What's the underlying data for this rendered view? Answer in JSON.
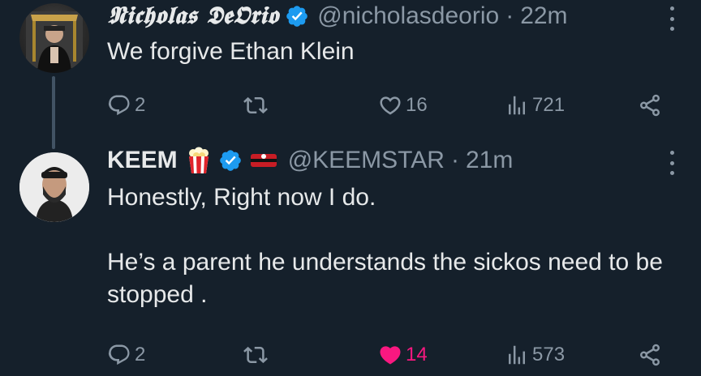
{
  "tweets": [
    {
      "name": "𝕹𝖎𝖈𝖍𝖔𝖑𝖆𝖘 𝕯𝖊𝕺𝖗𝖎𝖔",
      "handle": "@nicholasdeorio",
      "dot": "·",
      "time": "22m",
      "text": "We forgive Ethan Klein",
      "replies": "2",
      "likes": "16",
      "views": "721",
      "liked": false
    },
    {
      "name": "KEEM",
      "handle": "@KEEMSTAR",
      "dot": "·",
      "time": "21m",
      "text": "Honestly, Right now I do.\n\nHe’s a parent he understands the sickos need to be stopped .",
      "replies": "2",
      "likes": "14",
      "views": "573",
      "liked": true
    }
  ],
  "colors": {
    "background": "#15202b",
    "text": "#e7e9ea",
    "muted": "#8b98a5",
    "verified": "#1d9bf0",
    "like": "#f91880"
  },
  "icons": [
    "reply-icon",
    "retweet-icon",
    "heart-icon",
    "views-icon",
    "share-icon",
    "verified-badge-icon",
    "more-icon",
    "popcorn-icon"
  ]
}
